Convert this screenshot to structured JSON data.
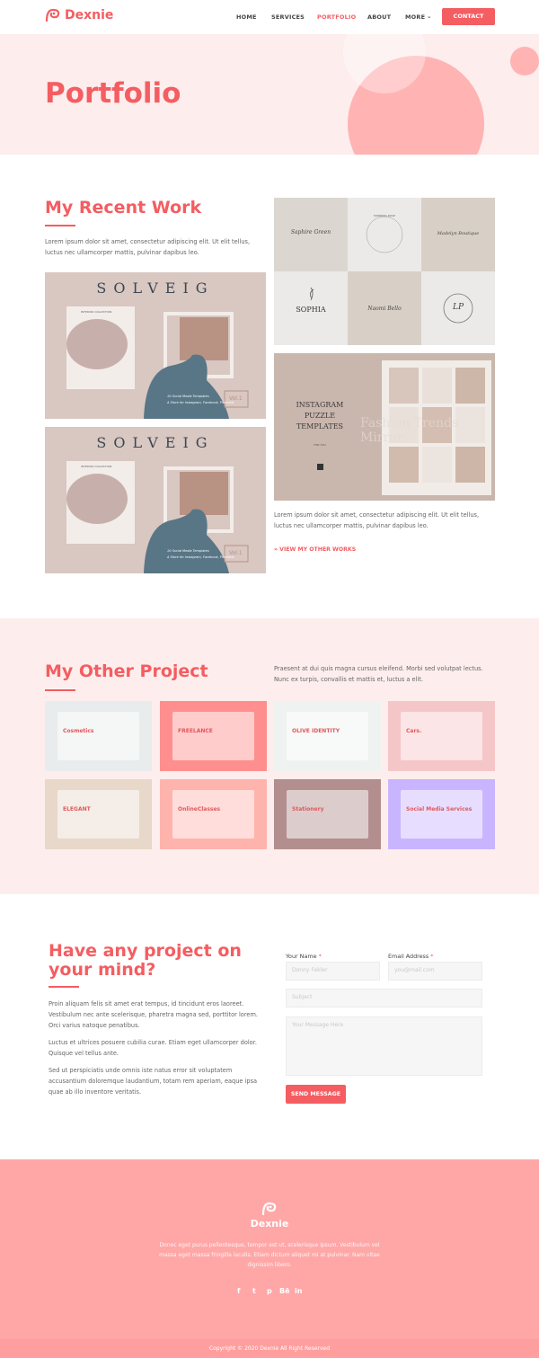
{
  "brand": {
    "name": "Dexnie",
    "accent": "#f45d61"
  },
  "nav": {
    "items": [
      "HOME",
      "SERVICES",
      "PORTFOLIO",
      "ABOUT",
      "MORE"
    ],
    "active": "PORTFOLIO",
    "contact": "CONTACT"
  },
  "hero": {
    "title": "Portfolio"
  },
  "recent": {
    "title": "My Recent Work",
    "intro": "Lorem ipsum dolor sit amet, consectetur adipiscing elit. Ut elit tellus, luctus nec ullamcorper mattis, pulvinar dapibus leo.",
    "outro": "Lorem ipsum dolor sit amet, consectetur adipiscing elit. Ut elit tellus, luctus nec ullamcorper mattis, pulvinar dapibus leo.",
    "link": "» VIEW MY OTHER WORKS",
    "solveig": {
      "title": "SOLVEIG",
      "collection": "INTERIOR COLLECTION",
      "caption1": "10 Social Media Templates",
      "caption2": "A Store for Instagram, Facebook, Pinterest",
      "vol": "Vol.1"
    },
    "logos": [
      "Saphire Green",
      "MORNING ROSE",
      "Madelyn Boutique",
      "SOPHIA",
      "Naomi Bello",
      "LP"
    ],
    "puzzle": {
      "title": "INSTAGRAM PUZZLE TEMPLATES",
      "sub": "FOR YOU",
      "bg_words": "Fashion Trends Mirror"
    }
  },
  "other": {
    "title": "My Other Project",
    "intro": "Praesent at dui quis magna cursus eleifend. Morbi sed volutpat lectus. Nunc ex turpis, convallis et mattis et, luctus a elit.",
    "tiles": [
      {
        "label": "Cosmetics",
        "bg": "#e9ecec"
      },
      {
        "label": "FREELANCE",
        "bg": "#ff8e8e"
      },
      {
        "label": "OLIVE IDENTITY",
        "bg": "#eef3f1"
      },
      {
        "label": "Cars.",
        "bg": "#f5c6c8"
      },
      {
        "label": "ELEGANT",
        "bg": "#e8d8c9"
      },
      {
        "label": "OnlineClasses",
        "bg": "#ffb3ad"
      },
      {
        "label": "Stationery",
        "bg": "#b38e8e"
      },
      {
        "label": "Social Media Services",
        "bg": "#c9b5ff"
      }
    ]
  },
  "contact": {
    "title": "Have any project on your mind?",
    "p1": "Proin aliquam felis sit amet erat tempus, id tincidunt eros laoreet. Vestibulum nec ante scelerisque, pharetra magna sed, porttitor lorem. Orci varius natoque penatibus.",
    "p2": "Luctus et ultrices posuere cubilia curae. Etiam eget ullamcorper dolor. Quisque vel tellus ante.",
    "p3": "Sed ut perspiciatis unde omnis iste natus error sit voluptatem accusantium doloremque laudantium, totam rem aperiam, eaque ipsa quae ab illo inventore veritatis.",
    "name_label": "Your Name",
    "email_label": "Email Address",
    "required": "*",
    "name_placeholder": "Donny Fekler",
    "email_placeholder": "you@mail.com",
    "subject_placeholder": "Subject",
    "message_placeholder": "Your Message Here",
    "send": "SEND MESSAGE"
  },
  "footer": {
    "brand": "Dexnie",
    "text": "Donec eget purus pellentesque, tempor est ut, scelerisque ipsum. Vestibulum vel massa eget massa fringilla iaculis. Etiam dictum aliquet mi at pulvinar. Nam vitae dignissim libero.",
    "social": [
      "f",
      "t",
      "p",
      "Bē",
      "in"
    ],
    "copyright": "Copyright © 2020 Dexnie All Right Reserved"
  }
}
